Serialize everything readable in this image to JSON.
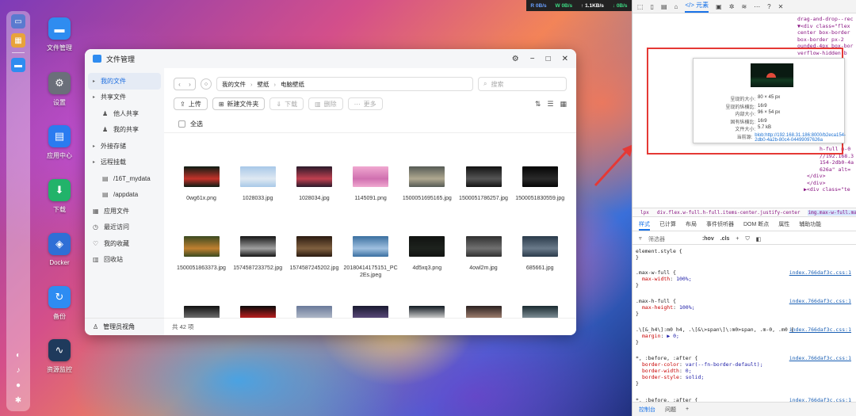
{
  "desktop": {
    "icons": [
      {
        "label": "文件管理",
        "color": "#2f8cf0",
        "glyph": "folder-icon"
      },
      {
        "label": "设置",
        "color": "#6b6f7a",
        "glyph": "gear-icon"
      },
      {
        "label": "应用中心",
        "color": "#2a7bf0",
        "glyph": "store-icon"
      },
      {
        "label": "下载",
        "color": "#22b36a",
        "glyph": "download-icon"
      },
      {
        "label": "Docker",
        "color": "#2f6fd6",
        "glyph": "docker-icon"
      },
      {
        "label": "备份",
        "color": "#2e8cf2",
        "glyph": "backup-icon"
      },
      {
        "label": "资源监控",
        "color": "#1f3a5c",
        "glyph": "monitor-icon"
      }
    ]
  },
  "netbar": {
    "r": "R 0B/s",
    "w": "W 0B/s",
    "up": "↑ 1.1KB/s",
    "down": "↓ 0B/s"
  },
  "window": {
    "title": "文件管理",
    "sidebar": {
      "items": [
        {
          "label": "我的文件",
          "type": "top",
          "active": true
        },
        {
          "label": "共享文件",
          "type": "top"
        },
        {
          "label": "他人共享",
          "type": "sub"
        },
        {
          "label": "我的共享",
          "type": "sub"
        },
        {
          "label": "外接存储",
          "type": "top"
        },
        {
          "label": "远程挂载",
          "type": "top"
        },
        {
          "label": "/16T_mydata",
          "type": "sub"
        },
        {
          "label": "/appdata",
          "type": "sub"
        },
        {
          "label": "应用文件",
          "type": "icon"
        },
        {
          "label": "最近访问",
          "type": "icon"
        },
        {
          "label": "我的收藏",
          "type": "icon"
        },
        {
          "label": "回收站",
          "type": "icon"
        }
      ],
      "footer": "管理员视角"
    },
    "breadcrumb": [
      "我的文件",
      "壁纸",
      "电脑壁纸"
    ],
    "search_placeholder": "搜索",
    "toolbar": {
      "upload": "上传",
      "new_folder": "新建文件夹",
      "download": "下载",
      "delete": "删除",
      "more": "更多"
    },
    "select_all": "全选",
    "files": [
      {
        "name": "0wg61x.png",
        "c1": "#0d1d14",
        "c2": "#c4322a"
      },
      {
        "name": "1028033.jpg",
        "c1": "#a8c8e8",
        "c2": "#dfe9f2"
      },
      {
        "name": "1028034.jpg",
        "c1": "#2a1a2a",
        "c2": "#c04050"
      },
      {
        "name": "1145091.png",
        "c1": "#f0a8d0",
        "c2": "#d070b0"
      },
      {
        "name": "1500051695165.jpg",
        "c1": "#555a55",
        "c2": "#b0a890"
      },
      {
        "name": "1500051786257.jpg",
        "c1": "#111111",
        "c2": "#555555"
      },
      {
        "name": "1500051830559.jpg",
        "c1": "#050505",
        "c2": "#2a2a2a"
      },
      {
        "name": "1500051863373.jpg",
        "c1": "#3a4a20",
        "c2": "#c08030"
      },
      {
        "name": "1574587233752.jpg",
        "c1": "#151515",
        "c2": "#a0a0a0"
      },
      {
        "name": "1574587245202.jpg",
        "c1": "#2a1a10",
        "c2": "#806040"
      },
      {
        "name": "20180414175151_PC2Es.jpeg",
        "c1": "#3a6fa0",
        "c2": "#a0c0e0"
      },
      {
        "name": "4d5xq3.png",
        "c1": "#111311",
        "c2": "#1d221d"
      },
      {
        "name": "4owl2m.jpg",
        "c1": "#303030",
        "c2": "#707070"
      },
      {
        "name": "685661.jpg",
        "c1": "#2a3a4a",
        "c2": "#6a7a8a"
      },
      {
        "name": "",
        "c1": "#111111",
        "c2": "#707070"
      },
      {
        "name": "",
        "c1": "#0a0a0a",
        "c2": "#c02020"
      },
      {
        "name": "",
        "c1": "#6a7a9a",
        "c2": "#b0b8c8"
      },
      {
        "name": "",
        "c1": "#1a1a30",
        "c2": "#5a4a7a"
      },
      {
        "name": "",
        "c1": "#101820",
        "c2": "#d0d0d0"
      },
      {
        "name": "",
        "c1": "#2a2020",
        "c2": "#a08070"
      },
      {
        "name": "",
        "c1": "#1a2a30",
        "c2": "#809098"
      }
    ],
    "status": "共 42 项"
  },
  "devtools": {
    "tabs": [
      "元素"
    ],
    "elements_lines": [
      "drag-and-drop--rec",
      "▼<div class=\"flex",
      "center box-border",
      "box-border px-2",
      "ounded-4px box-bor",
      "verflow-hidden b"
    ],
    "elements_lines_lower": [
      "h-full m-0",
      "//192.168.3",
      "154-2db0-4a",
      "626a\" alt=",
      "</div>",
      "</div>",
      "▶<div class=\"te"
    ],
    "tooltip": {
      "rows": [
        {
          "k": "呈现的大小:",
          "v": "80 × 45 px"
        },
        {
          "k": "呈现的纵横比:",
          "v": "16∶9"
        },
        {
          "k": "内部大小:",
          "v": "96 × 54 px"
        },
        {
          "k": "固有纵横比:",
          "v": "16∶9"
        },
        {
          "k": "文件大小:",
          "v": "5.7 kB"
        },
        {
          "k": "当前源:",
          "v": "blob:http://192.168.31.186:8000/b2eca154-2db0-4a2b-80c4-04499097626a"
        }
      ]
    },
    "crumbs": [
      "lpx",
      "div.flex.w-full.h-full.items-center.justify-center",
      "img.max-w-full.max-h-full.m-0"
    ],
    "style_tabs": [
      "样式",
      "已计算",
      "布局",
      "事件侦听器",
      "DOM 断点",
      "属性",
      "辅助功能"
    ],
    "filter": {
      "placeholder": "筛选器",
      "hov": ":hov",
      "cls": ".cls"
    },
    "rules": [
      {
        "sel": "element.style {",
        "src": "",
        "props": [],
        "end": "}"
      },
      {
        "sel": ".max-w-full {",
        "src": "index.766daf3c.css:1",
        "props": [
          [
            "max-width",
            "100%;"
          ]
        ],
        "end": "}"
      },
      {
        "sel": ".max-h-full {",
        "src": "index.766daf3c.css:1",
        "props": [
          [
            "max-height",
            "100%;"
          ]
        ],
        "end": "}"
      },
      {
        "sel": ".\\[&_h4\\]:m0 h4, .\\[&\\>span\\]\\:m0>span, .m-0, .m0 {",
        "src": "index.766daf3c.css:1",
        "props": [
          [
            "margin",
            "▶ 0;"
          ]
        ],
        "end": "}"
      },
      {
        "sel": "*, :before, :after {",
        "src": "index.766daf3c.css:1",
        "props": [
          [
            "border-color",
            "var(--fn-border-default);"
          ],
          [
            "border-width",
            "0;"
          ],
          [
            "border-style",
            "solid;"
          ]
        ],
        "end": "}"
      },
      {
        "sel": "*, :before, :after {",
        "src": "index.766daf3c.css:1",
        "props": [
          [
            "--un-rotate",
            "0;"
          ]
        ],
        "end": ""
      }
    ],
    "footer": [
      "控制台",
      "问题"
    ]
  }
}
